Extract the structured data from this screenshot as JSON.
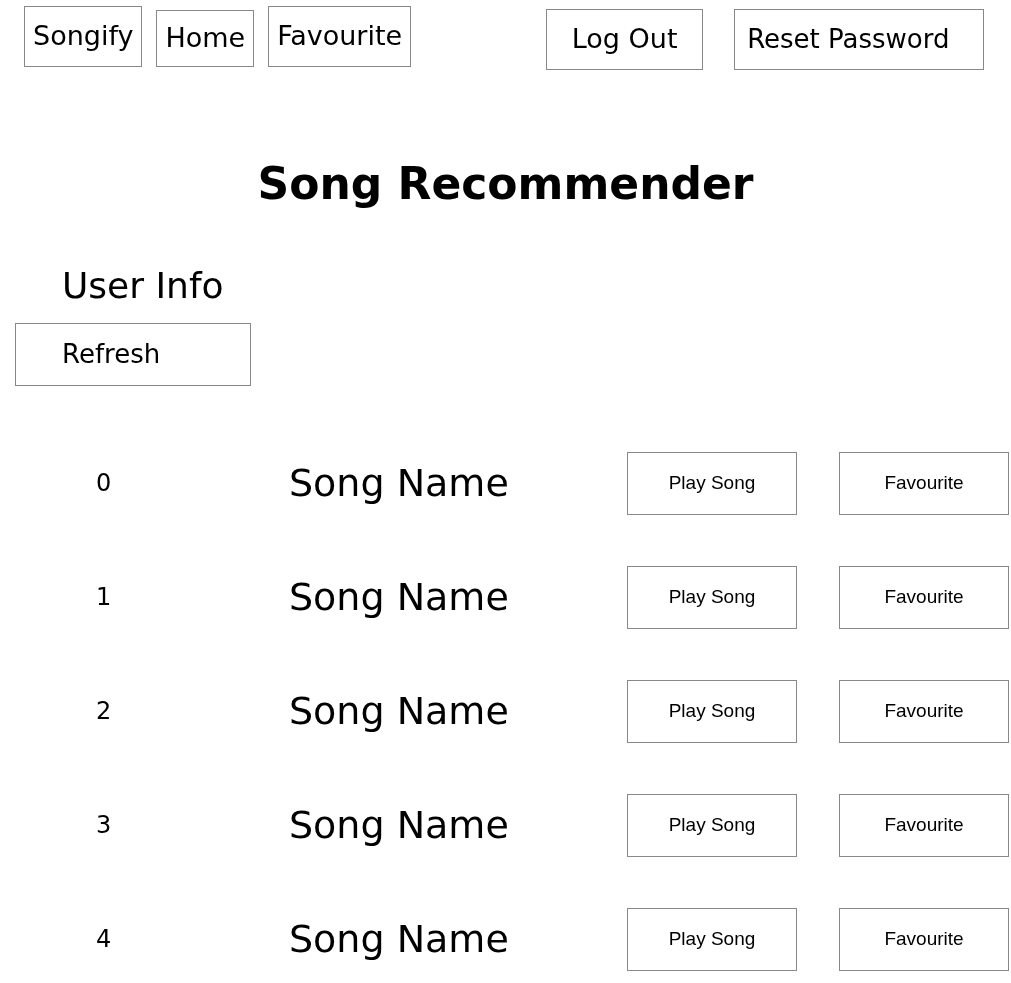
{
  "nav": {
    "left": [
      {
        "label": "Songify"
      },
      {
        "label": "Home"
      },
      {
        "label": "Favourite"
      }
    ],
    "right": [
      {
        "label": "Log Out"
      },
      {
        "label": "Reset Password"
      }
    ]
  },
  "title": "Song Recommender",
  "user_info": "User Info",
  "refresh_button": "Refresh",
  "songs": [
    {
      "index": "0",
      "name": "Song Name",
      "play_button": "Play Song",
      "favourite_button": "Favourite"
    },
    {
      "index": "1",
      "name": "Song Name",
      "play_button": "Play Song",
      "favourite_button": "Favourite"
    },
    {
      "index": "2",
      "name": "Song Name",
      "play_button": "Play Song",
      "favourite_button": "Favourite"
    },
    {
      "index": "3",
      "name": "Song Name",
      "play_button": "Play Song",
      "favourite_button": "Favourite"
    },
    {
      "index": "4",
      "name": "Song Name",
      "play_button": "Play Song",
      "favourite_button": "Favourite"
    }
  ]
}
